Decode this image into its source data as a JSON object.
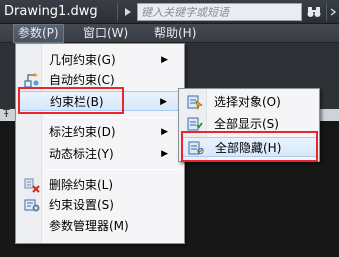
{
  "title_bar": {
    "document_title": "Drawing1.dwg",
    "search_placeholder": "键入关键字或短语",
    "search_icon": "binoculars-icon"
  },
  "menubar": {
    "items": [
      {
        "label": "参数(P)",
        "active": true
      },
      {
        "label": "窗口(W)",
        "active": false
      },
      {
        "label": "帮助(H)",
        "active": false
      }
    ]
  },
  "strip": {
    "left_glyph": "Ŧ"
  },
  "menu": {
    "items": [
      {
        "label": "几何约束(G)",
        "has_submenu": true,
        "icon": ""
      },
      {
        "label": "自动约束(C)",
        "has_submenu": false,
        "icon": "auto-constrain-icon"
      },
      {
        "label": "约束栏(B)",
        "has_submenu": true,
        "icon": "",
        "highlighted": true
      },
      {
        "label": "标注约束(D)",
        "has_submenu": true,
        "icon": ""
      },
      {
        "label": "动态标注(Y)",
        "has_submenu": true,
        "icon": ""
      },
      {
        "label": "删除约束(L)",
        "has_submenu": false,
        "icon": "delete-constraint-icon"
      },
      {
        "label": "约束设置(S)",
        "has_submenu": false,
        "icon": "constraint-settings-icon"
      },
      {
        "label": "参数管理器(M)",
        "has_submenu": false,
        "icon": ""
      }
    ]
  },
  "submenu": {
    "items": [
      {
        "label": "选择对象(O)",
        "icon": "select-objects-icon"
      },
      {
        "label": "全部显示(S)",
        "icon": "show-all-icon"
      },
      {
        "label": "全部隐藏(H)",
        "icon": "hide-all-icon",
        "highlighted": true
      }
    ]
  },
  "colors": {
    "highlight_border": "#e8262b",
    "menubar_bg": "#3d4249",
    "menu_bg": "#f5f5f7"
  }
}
